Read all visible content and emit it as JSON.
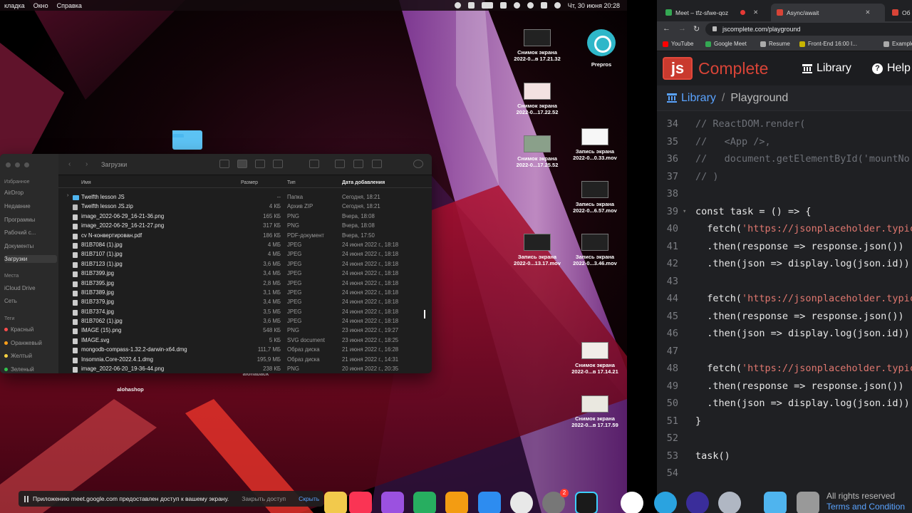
{
  "menubar": {
    "items": [
      "кладка",
      "Окно",
      "Справка"
    ],
    "datetime": "Чт, 30 июня  20:28"
  },
  "desktop": {
    "icons": [
      {
        "label1": "Снимок экрана",
        "label2": "2022-0...в 17.21.32"
      },
      {
        "label1": "Prepros",
        "label2": ""
      },
      {
        "label1": "Снимок экрана",
        "label2": "2022-0...17.22.52"
      },
      {
        "label1": "Снимок экрана",
        "label2": "2022-0...17.25.52"
      },
      {
        "label1": "Запись экрана",
        "label2": "2022-0...0.33.mov"
      },
      {
        "label1": "Запись экрана",
        "label2": "2022-0...6.57.mov"
      },
      {
        "label1": "Запись экрана",
        "label2": "2022-0...13.17.mov"
      },
      {
        "label1": "Запись экрана",
        "label2": "2022-0...3.46.mov"
      },
      {
        "label1": "Снимок экрана",
        "label2": "2022-0...в 17.14.21"
      },
      {
        "label1": "Снимок экрана",
        "label2": "2022-0...в 17.17.59"
      },
      {
        "label1": "alohashop",
        "label2": ""
      },
      {
        "label1": "alohaback",
        "label2": ""
      }
    ]
  },
  "finder": {
    "title": "Загрузки",
    "sidebar": {
      "favorites_label": "Избранное",
      "favorites": [
        "AirDrop",
        "Недавние",
        "Программы",
        "Рабочий с...",
        "Документы",
        "Загрузки"
      ],
      "places_label": "Места",
      "places": [
        "iCloud Drive",
        "Сеть"
      ],
      "tags_label": "Теги",
      "tags": [
        {
          "name": "Красный",
          "color": "#ff4d4d"
        },
        {
          "name": "Оранжевый",
          "color": "#ff9f1a"
        },
        {
          "name": "Желтый",
          "color": "#f5d142"
        },
        {
          "name": "Зеленый",
          "color": "#33c24d"
        }
      ]
    },
    "columns": {
      "name": "Имя",
      "size": "Размер",
      "type": "Тип",
      "date": "Дата добавления"
    },
    "rows": [
      {
        "name": "Twelfth lesson JS",
        "size": "--",
        "type": "Папка",
        "date": "Сегодня, 18:21",
        "kind": "folder"
      },
      {
        "name": "Twelfth lesson JS.zip",
        "size": "4 КБ",
        "type": "Архив ZIP",
        "date": "Сегодня, 18:21",
        "kind": "zip"
      },
      {
        "name": "image_2022-06-29_16-21-36.png",
        "size": "165 КБ",
        "type": "PNG",
        "date": "Вчера, 18:08",
        "kind": "file"
      },
      {
        "name": "image_2022-06-29_16-21-27.png",
        "size": "317 КБ",
        "type": "PNG",
        "date": "Вчера, 18:08",
        "kind": "file"
      },
      {
        "name": "cv N-конвертирован.pdf",
        "size": "186 КБ",
        "type": "PDF-документ",
        "date": "Вчера, 17:50",
        "kind": "file"
      },
      {
        "name": "8I1B7084 (1).jpg",
        "size": "4 МБ",
        "type": "JPEG",
        "date": "24 июня 2022 г., 18:18",
        "kind": "file"
      },
      {
        "name": "8I1B7107 (1).jpg",
        "size": "4 МБ",
        "type": "JPEG",
        "date": "24 июня 2022 г., 18:18",
        "kind": "file"
      },
      {
        "name": "8I1B7123 (1).jpg",
        "size": "3,6 МБ",
        "type": "JPEG",
        "date": "24 июня 2022 г., 18:18",
        "kind": "file"
      },
      {
        "name": "8I1B7399.jpg",
        "size": "3,4 МБ",
        "type": "JPEG",
        "date": "24 июня 2022 г., 18:18",
        "kind": "file"
      },
      {
        "name": "8I1B7395.jpg",
        "size": "2,8 МБ",
        "type": "JPEG",
        "date": "24 июня 2022 г., 18:18",
        "kind": "file"
      },
      {
        "name": "8I1B7389.jpg",
        "size": "3,1 МБ",
        "type": "JPEG",
        "date": "24 июня 2022 г., 18:18",
        "kind": "file"
      },
      {
        "name": "8I1B7379.jpg",
        "size": "3,4 МБ",
        "type": "JPEG",
        "date": "24 июня 2022 г., 18:18",
        "kind": "file"
      },
      {
        "name": "8I1B7374.jpg",
        "size": "3,5 МБ",
        "type": "JPEG",
        "date": "24 июня 2022 г., 18:18",
        "kind": "file"
      },
      {
        "name": "8I1B7062 (1).jpg",
        "size": "3,6 МБ",
        "type": "JPEG",
        "date": "24 июня 2022 г., 18:18",
        "kind": "file"
      },
      {
        "name": "IMAGE (15).png",
        "size": "548 КБ",
        "type": "PNG",
        "date": "23 июня 2022 г., 19:27",
        "kind": "file"
      },
      {
        "name": "IMAGE.svg",
        "size": "5 КБ",
        "type": "SVG document",
        "date": "23 июня 2022 г., 18:25",
        "kind": "file"
      },
      {
        "name": "mongodb-compass-1.32.2-darwin-x64.dmg",
        "size": "111,7 МБ",
        "type": "Образ диска",
        "date": "21 июня 2022 г., 16:28",
        "kind": "file"
      },
      {
        "name": "Insomnia.Core-2022.4.1.dmg",
        "size": "195,9 МБ",
        "type": "Образ диска",
        "date": "21 июня 2022 г., 14:31",
        "kind": "file"
      },
      {
        "name": "image_2022-06-20_19-36-44.png",
        "size": "238 КБ",
        "type": "PNG",
        "date": "20 июня 2022 г., 20:35",
        "kind": "file"
      }
    ]
  },
  "browser": {
    "tabs": [
      {
        "label": "Meet – tfz-sfwe-qoz"
      },
      {
        "label": "Async/await"
      },
      {
        "label": "Об"
      }
    ],
    "url": "jscomplete.com/playground",
    "bookmarks": [
      {
        "label": "YouTube",
        "color": "#ff0000"
      },
      {
        "label": "Google Meet",
        "color": "#34a853"
      },
      {
        "label": "Resume",
        "color": "#aaaaaa"
      },
      {
        "label": "Front-End 16:00 I...",
        "color": "#c8b400"
      },
      {
        "label": "Example Bo",
        "color": "#aaaaaa"
      }
    ],
    "logo_mark": "js",
    "logo_text": "Complete",
    "nav_library": "Library",
    "nav_help": "Help",
    "breadcrumb_library": "Library",
    "breadcrumb_sep": "/",
    "breadcrumb_page": "Playground",
    "code_lines": [
      {
        "n": "34",
        "text": "// ReactDOM.render(",
        "cls": "c-cm",
        "fold": ""
      },
      {
        "n": "35",
        "text": "//   <App />,",
        "cls": "c-cm",
        "fold": ""
      },
      {
        "n": "36",
        "text": "//   document.getElementById('mountNo",
        "cls": "c-cm",
        "fold": ""
      },
      {
        "n": "37",
        "text": "// )",
        "cls": "c-cm",
        "fold": ""
      },
      {
        "n": "38",
        "text": "",
        "cls": "",
        "fold": ""
      },
      {
        "n": "39",
        "text": "const task = () => {",
        "cls": "c-kw",
        "fold": "▾"
      },
      {
        "n": "40",
        "pre": "  fetch(",
        "str": "'https://jsonplaceholder.typic",
        "cls": "",
        "fold": ""
      },
      {
        "n": "41",
        "text": "  .then(response => response.json())",
        "cls": "c-kw",
        "fold": ""
      },
      {
        "n": "42",
        "text": "  .then(json => display.log(json.id))",
        "cls": "c-kw",
        "fold": ""
      },
      {
        "n": "43",
        "text": "",
        "cls": "",
        "fold": ""
      },
      {
        "n": "44",
        "pre": "  fetch(",
        "str": "'https://jsonplaceholder.typic",
        "cls": "",
        "fold": ""
      },
      {
        "n": "45",
        "text": "  .then(response => response.json())",
        "cls": "c-kw",
        "fold": ""
      },
      {
        "n": "46",
        "text": "  .then(json => display.log(json.id))",
        "cls": "c-kw",
        "fold": ""
      },
      {
        "n": "47",
        "text": "",
        "cls": "",
        "fold": ""
      },
      {
        "n": "48",
        "pre": "  fetch(",
        "str": "'https://jsonplaceholder.typic",
        "cls": "",
        "fold": ""
      },
      {
        "n": "49",
        "text": "  .then(response => response.json())",
        "cls": "c-kw",
        "fold": ""
      },
      {
        "n": "50",
        "text": "  .then(json => display.log(json.id))",
        "cls": "c-kw",
        "fold": ""
      },
      {
        "n": "51",
        "text": "}",
        "cls": "c-kw",
        "fold": ""
      },
      {
        "n": "52",
        "text": "",
        "cls": "",
        "fold": ""
      },
      {
        "n": "53",
        "text": "task()",
        "cls": "c-kw",
        "fold": ""
      },
      {
        "n": "54",
        "text": "",
        "cls": "",
        "fold": ""
      }
    ],
    "footer_rights": "All rights reserved",
    "footer_terms": "Terms and Condition"
  },
  "notification": {
    "text": "Приложению meet.google.com предоставлен доступ к вашему экрану.",
    "stop": "Закрыть доступ",
    "hide": "Скрыть"
  },
  "dock": {
    "badge": "2",
    "apps": [
      "folder-icon",
      "music-icon",
      "podcasts-icon",
      "numbers-icon",
      "pages-icon",
      "app-store-icon",
      "chrome-icon",
      "settings-icon",
      "webstorm-icon",
      "mongodb-icon",
      "telegram-icon",
      "firefox-icon",
      "search-icon",
      "downloads-icon",
      "trash-icon"
    ]
  }
}
